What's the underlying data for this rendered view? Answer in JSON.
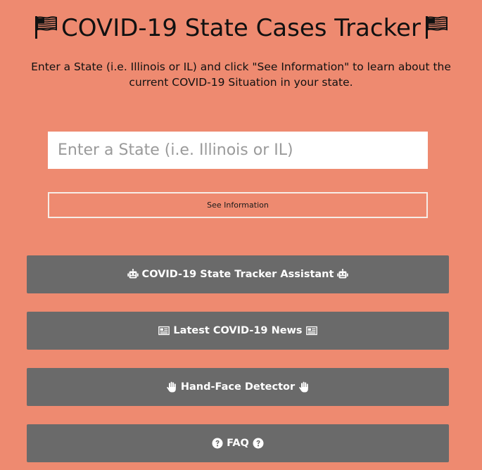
{
  "header": {
    "title": "COVID-19 State Cases Tracker",
    "title_icon": "flag-usa-icon"
  },
  "intro": {
    "text": "Enter a State (i.e. Illinois or IL) and click \"See Information\" to learn about the current COVID-19 Situation in your state."
  },
  "search": {
    "placeholder": "Enter a State (i.e. Illinois or IL)",
    "value": "",
    "button_label": "See Information"
  },
  "nav_buttons": [
    {
      "label": "COVID-19 State Tracker Assistant",
      "icon": "robot-icon"
    },
    {
      "label": "Latest COVID-19 News",
      "icon": "newspaper-icon"
    },
    {
      "label": "Hand-Face Detector",
      "icon": "hand-icon"
    },
    {
      "label": "FAQ",
      "icon": "question-circle-icon"
    }
  ],
  "colors": {
    "background": "#ee8a70",
    "button_bg": "#6a6a6a",
    "button_text": "#ffffff",
    "input_bg": "#ffffff",
    "outline_button_border": "#f6ece6"
  }
}
